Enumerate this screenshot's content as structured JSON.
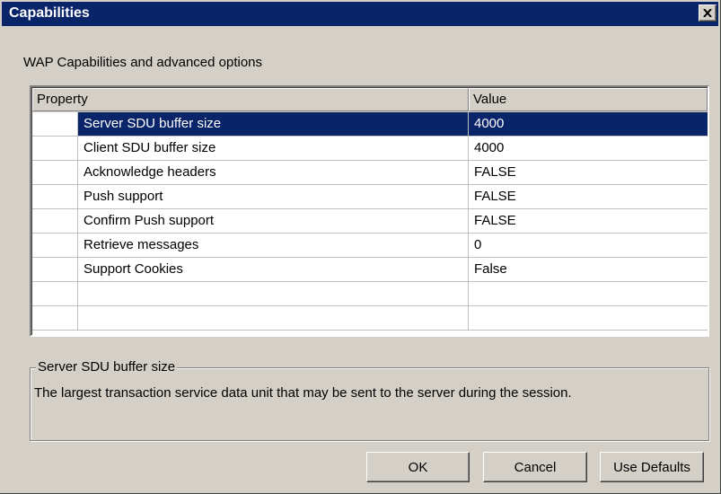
{
  "window": {
    "title": "Capabilities"
  },
  "subtitle": "WAP Capabilities and advanced options",
  "grid": {
    "columns": [
      "Property",
      "Value"
    ],
    "rows": [
      {
        "property": "Server SDU buffer size",
        "value": "4000",
        "selected": true
      },
      {
        "property": "Client SDU buffer size",
        "value": "4000"
      },
      {
        "property": "Acknowledge headers",
        "value": "FALSE"
      },
      {
        "property": "Push support",
        "value": "FALSE"
      },
      {
        "property": "Confirm Push support",
        "value": "FALSE"
      },
      {
        "property": "Retrieve messages",
        "value": "0"
      },
      {
        "property": "Support Cookies",
        "value": "False"
      },
      {
        "property": "",
        "value": ""
      },
      {
        "property": "",
        "value": ""
      }
    ]
  },
  "description": {
    "title": "Server SDU buffer size",
    "text": "The largest transaction service data unit that may be sent to the server during the session."
  },
  "buttons": {
    "ok": "OK",
    "cancel": "Cancel",
    "defaults": "Use Defaults"
  },
  "icons": {
    "close": "close-icon"
  },
  "colors": {
    "titlebar": "#0a246a",
    "selection": "#0a246a",
    "face": "#d4d0c8"
  }
}
